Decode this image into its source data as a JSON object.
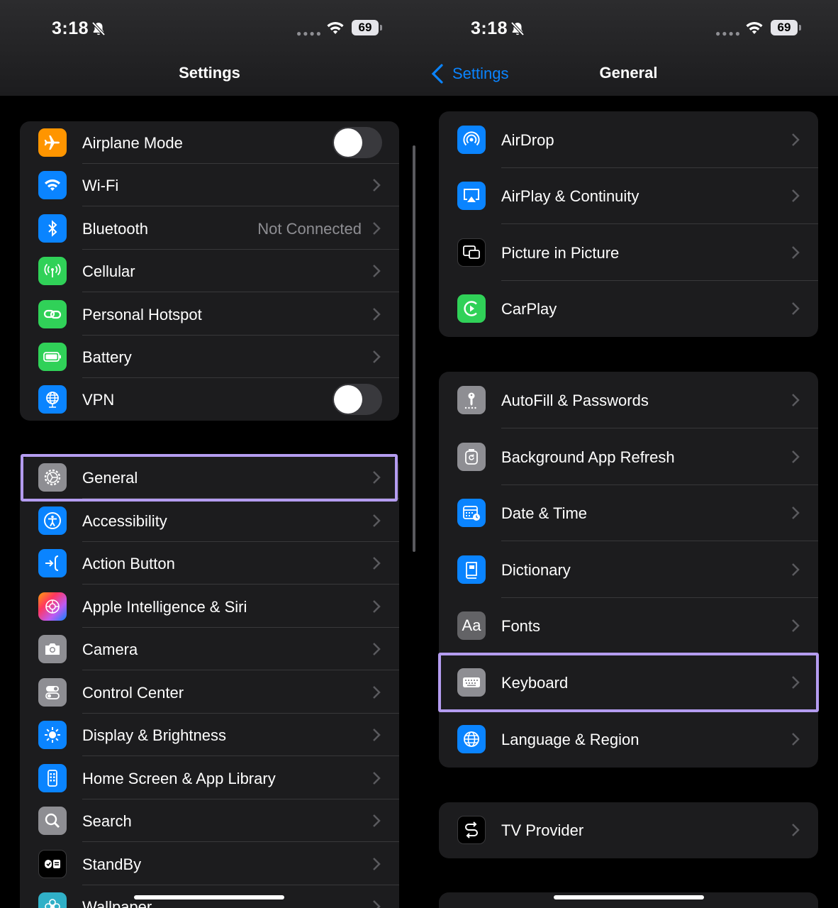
{
  "left": {
    "status": {
      "time": "3:18",
      "battery": "69"
    },
    "nav_title": "Settings",
    "group1": [
      {
        "label": "Airplane Mode",
        "toggle": false,
        "icon": "airplane-icon",
        "color": "#ff9500"
      },
      {
        "label": "Wi-Fi",
        "value": "",
        "icon": "wifi-icon",
        "color": "#0a84ff"
      },
      {
        "label": "Bluetooth",
        "value": "Not Connected",
        "icon": "bluetooth-icon",
        "color": "#0a84ff"
      },
      {
        "label": "Cellular",
        "icon": "antenna-icon",
        "color": "#30d158"
      },
      {
        "label": "Personal Hotspot",
        "icon": "link-icon",
        "color": "#30d158"
      },
      {
        "label": "Battery",
        "icon": "battery-icon",
        "color": "#30d158"
      },
      {
        "label": "VPN",
        "toggle": false,
        "icon": "globe-icon",
        "color": "#0a84ff"
      }
    ],
    "group2": [
      {
        "label": "General",
        "icon": "gear-icon",
        "color": "#8e8e93",
        "highlighted": true
      },
      {
        "label": "Accessibility",
        "icon": "accessibility-icon",
        "color": "#0a84ff"
      },
      {
        "label": "Action Button",
        "icon": "action-button-icon",
        "color": "#0a84ff"
      },
      {
        "label": "Apple Intelligence & Siri",
        "icon": "siri-icon",
        "color": "#bf5af2"
      },
      {
        "label": "Camera",
        "icon": "camera-icon",
        "color": "#8e8e93"
      },
      {
        "label": "Control Center",
        "icon": "switches-icon",
        "color": "#8e8e93"
      },
      {
        "label": "Display & Brightness",
        "icon": "sun-icon",
        "color": "#0a84ff"
      },
      {
        "label": "Home Screen & App Library",
        "icon": "phone-grid-icon",
        "color": "#0a84ff"
      },
      {
        "label": "Search",
        "icon": "magnifier-icon",
        "color": "#8e8e93"
      },
      {
        "label": "StandBy",
        "icon": "standby-icon",
        "color": "#1c1c1e"
      },
      {
        "label": "Wallpaper",
        "icon": "flower-icon",
        "color": "#30b0c7"
      }
    ]
  },
  "right": {
    "status": {
      "time": "3:18",
      "battery": "69"
    },
    "back_label": "Settings",
    "nav_title": "General",
    "group1": [
      {
        "label": "AirDrop",
        "icon": "airdrop-icon",
        "color": "#0a84ff"
      },
      {
        "label": "AirPlay & Continuity",
        "icon": "airplay-icon",
        "color": "#0a84ff"
      },
      {
        "label": "Picture in Picture",
        "icon": "pip-icon",
        "color": "#000000"
      },
      {
        "label": "CarPlay",
        "icon": "carplay-icon",
        "color": "#30d158"
      }
    ],
    "group2": [
      {
        "label": "AutoFill & Passwords",
        "icon": "key-icon",
        "color": "#8e8e93"
      },
      {
        "label": "Background App Refresh",
        "icon": "refresh-icon",
        "color": "#8e8e93"
      },
      {
        "label": "Date & Time",
        "icon": "calendar-clock-icon",
        "color": "#0a84ff"
      },
      {
        "label": "Dictionary",
        "icon": "book-icon",
        "color": "#0a84ff"
      },
      {
        "label": "Fonts",
        "icon": "fonts-icon",
        "color": "#8e8e93"
      },
      {
        "label": "Keyboard",
        "icon": "keyboard-icon",
        "color": "#8e8e93",
        "highlighted": true
      },
      {
        "label": "Language & Region",
        "icon": "globe-icon",
        "color": "#0a84ff"
      }
    ],
    "group3": [
      {
        "label": "TV Provider",
        "icon": "tv-provider-icon",
        "color": "#000000"
      }
    ]
  }
}
